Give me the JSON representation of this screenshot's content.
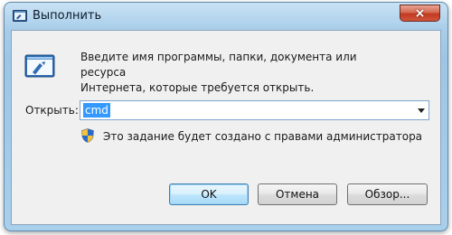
{
  "window": {
    "title": "Выполнить",
    "close_label": "×"
  },
  "dialog": {
    "description_line1": "Введите имя программы, папки, документа или ресурса",
    "description_line2": "Интернета, которые требуется открыть.",
    "open_label": "Открыть:",
    "open_value": "cmd",
    "admin_note": "Это задание будет создано с правами администратора"
  },
  "buttons": {
    "ok": "OK",
    "cancel": "Отмена",
    "browse": "Обзор..."
  },
  "colors": {
    "selection": "#3399ff",
    "close_button": "#c13a21",
    "frame": "#a8cde9"
  },
  "icons": {
    "title": "run-icon",
    "main": "run-program-icon",
    "admin": "uac-shield-icon",
    "dropdown": "chevron-down-icon"
  }
}
